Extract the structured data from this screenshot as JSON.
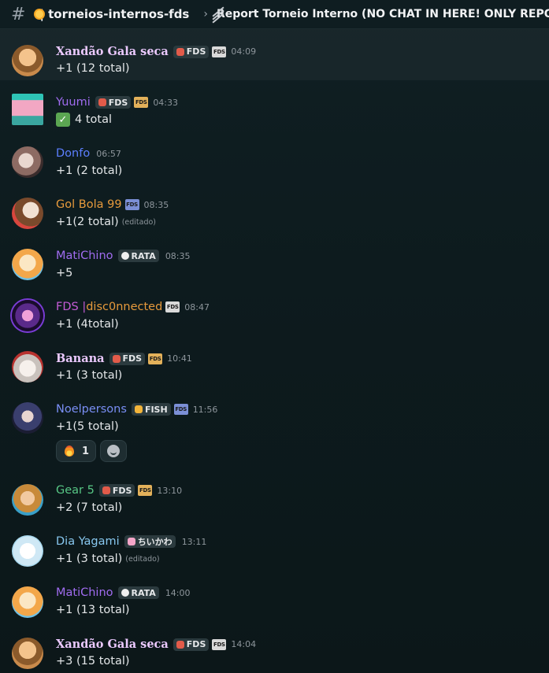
{
  "header": {
    "hash_icon": "hashtag-icon",
    "emoji_icon": "sun-emoji",
    "channel": "| torneios-internos-fds",
    "thread_icon": "thread-icon",
    "thread": "Report Torneio Interno (NO CHAT IN HERE! ONLY REPORTS)"
  },
  "messages": [
    {
      "user": "Xandão Gala seca",
      "tag": "FDS",
      "badge": "FDS",
      "time": "04:09",
      "text": "+1 (12 total)"
    },
    {
      "user": "Yuumi",
      "tag": "FDS",
      "badge": "FDS",
      "time": "04:33",
      "text": "4 total"
    },
    {
      "user": "Donfo",
      "time": "06:57",
      "text": "+1 (2 total)"
    },
    {
      "user": "Gol Bola 99",
      "badge": "FDS",
      "time": "08:35",
      "text": "+1(2 total)",
      "edited": "(editado)"
    },
    {
      "user": "MatiChino",
      "tag": "RATA",
      "time": "08:35",
      "text": "+5"
    },
    {
      "user_prefix": "FDS | ",
      "user": "disc0nnected",
      "badge": "FDS",
      "time": "08:47",
      "text": "+1 (4total)"
    },
    {
      "user": "Banana",
      "tag": "FDS",
      "badge": "FDS",
      "time": "10:41",
      "text": "+1 (3 total)"
    },
    {
      "user": "Noelpersons",
      "tag": "FISH",
      "badge": "FDS",
      "time": "11:56",
      "text": "+1(5 total)",
      "reaction_count": "1"
    },
    {
      "user": "Gear 5",
      "tag": "FDS",
      "badge": "FDS",
      "time": "13:10",
      "text": "+2 (7 total)"
    },
    {
      "user": "Dia Yagami",
      "tag": "ちいかわ",
      "time": "13:11",
      "text": "+1 (3 total)",
      "edited": "(editado)"
    },
    {
      "user": "MatiChino",
      "tag": "RATA",
      "time": "14:00",
      "text": "+1 (13 total)"
    },
    {
      "user": "Xandão Gala seca",
      "tag": "FDS",
      "badge": "FDS",
      "time": "14:04",
      "text": "+3  (15 total)"
    }
  ],
  "colors": {
    "purple_name": "#a06cf0",
    "blue_name": "#5c7fff",
    "orange_name": "#e79a3c",
    "green_name": "#57c785",
    "cyan_name": "#88c8f0"
  }
}
